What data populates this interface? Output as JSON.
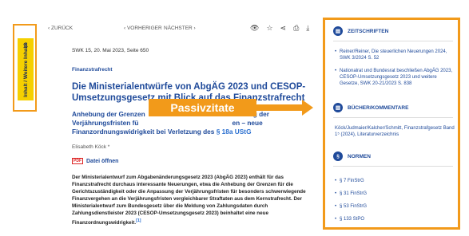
{
  "side_tab": {
    "label": "Inhalt / Weitere Inhalte",
    "arrow": "⇅"
  },
  "toolbar": {
    "back": "‹ ZURÜCK",
    "prev": "‹ VORHERIGER",
    "next": "NÄCHSTER ›"
  },
  "article": {
    "meta": "SWK 15, 20. Mai 2023, Seite 650",
    "rubric": "Finanzstrafrecht",
    "title": "Die Ministerialentwürfe von AbgÄG 2023 und CESOP-Umsetzungsgesetz mit Blick auf das Finanzstrafrecht",
    "subtitle_line1": "Anhebung der Grenzen",
    "subtitle_line1_end": "g der",
    "subtitle_line2": "Verjährungsfristen fü",
    "subtitle_line2_end": "en – neue",
    "subtitle_line3": "Finanzordnungswidrigkeit bei Verletzung des ",
    "subtitle_law": "§ 18a UStG",
    "author": "Elisabeth Köck *",
    "file_label": "Datei öffnen",
    "pdf": "PDF",
    "body": "Der Ministerialentwurf zum Abgabenänderungsgesetz 2023 (AbgÄG 2023) enthält für das Finanzstrafrecht durchaus interessante Neuerungen, etwa die Anhebung der Grenzen für die Gerichtszuständigkeit oder die Anpassung der Verjährungsfristen für besonders schwerwiegende Finanzvergehen an die Verjährungsfristen vergleichbarer Straftaten aus dem Kernstrafrecht. Der Ministerialentwurf zum Bundesgesetz über die Meldung von Zahlungsdaten durch Zahlungsdienstleister 2023 (CESOP-Umsetzungsgesetz 2023) beinhaltet eine neue Finanzordnungswidrigkeit.",
    "footnote": "[1]"
  },
  "banner": {
    "label": "Passivzitate"
  },
  "right_panel": {
    "zeitschriften": {
      "heading": "ZEITSCHRIFTEN",
      "items": [
        "Reiner/Reiner, Die steuerlichen Neuerungen 2024, SWK 3/2024 S. 52",
        "Nationalrat und Bundesrat beschließen AbgÄG 2023, CESOP-Umsetzungsgesetz 2023 und weitere Gesetze, SWK 20-21/2023 S. 838"
      ]
    },
    "buecher": {
      "heading": "BÜCHER/KOMMENTARE",
      "item": "Köck/Judmaier/Kalcher/Schmitt, Finanzstrafgesetz Band 1⁵ (2024), Literaturverzeichnis"
    },
    "normen": {
      "heading": "NORMEN",
      "items": [
        "§ 7 FinStrG",
        "§ 31 FinStrG",
        "§ 53 FinStrG",
        "§ 133 StPO"
      ]
    }
  }
}
